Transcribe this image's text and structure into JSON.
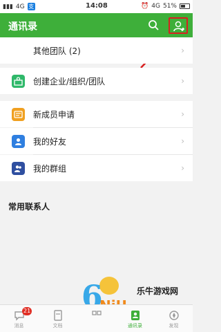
{
  "status": {
    "signal_left": "4G",
    "alipay": "支",
    "time": "14:08",
    "network_right": "4G",
    "battery": "51%"
  },
  "appbar": {
    "title": "通讯录",
    "search_icon": "search-icon",
    "add_contact_icon": "add-contact-icon"
  },
  "rows": {
    "other_team": "其他团队 (2)",
    "create_org": "创建企业/组织/团队",
    "new_member": "新成员申请",
    "my_friends": "我的好友",
    "my_groups": "我的群组"
  },
  "section": {
    "frequent_contacts": "常用联系人"
  },
  "tabs": [
    {
      "label": "消息",
      "badge": "21"
    },
    {
      "label": "文档"
    },
    {
      "label": ""
    },
    {
      "label": "通讯录"
    },
    {
      "label": "发现"
    }
  ],
  "watermark": {
    "brand_number": "6",
    "brand_word": "NiU",
    "site": "乐牛游戏网"
  },
  "colors": {
    "accent": "#3eaf3a",
    "highlight": "#d82020"
  }
}
